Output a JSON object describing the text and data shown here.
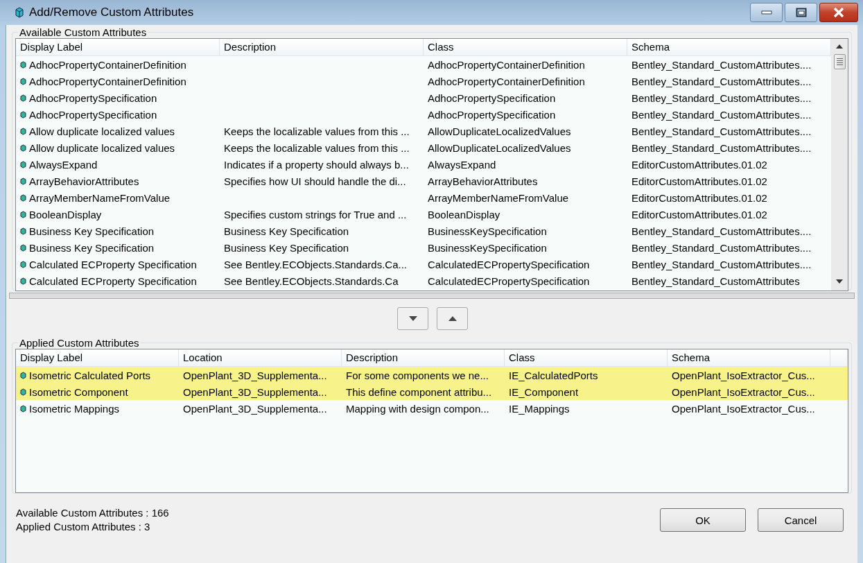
{
  "window": {
    "title": "Add/Remove Custom Attributes"
  },
  "available": {
    "title": "Available Custom Attributes",
    "columns": [
      "Display Label",
      "Description",
      "Class",
      "Schema"
    ],
    "rows": [
      {
        "cells": [
          "AdhocPropertyContainerDefinition",
          "",
          "AdhocPropertyContainerDefinition",
          "Bentley_Standard_CustomAttributes...."
        ]
      },
      {
        "cells": [
          "AdhocPropertyContainerDefinition",
          "",
          "AdhocPropertyContainerDefinition",
          "Bentley_Standard_CustomAttributes...."
        ]
      },
      {
        "cells": [
          "AdhocPropertySpecification",
          "",
          "AdhocPropertySpecification",
          "Bentley_Standard_CustomAttributes...."
        ]
      },
      {
        "cells": [
          "AdhocPropertySpecification",
          "",
          "AdhocPropertySpecification",
          "Bentley_Standard_CustomAttributes...."
        ]
      },
      {
        "cells": [
          "Allow duplicate localized values",
          "Keeps the localizable values from this ...",
          "AllowDuplicateLocalizedValues",
          "Bentley_Standard_CustomAttributes...."
        ]
      },
      {
        "cells": [
          "Allow duplicate localized values",
          "Keeps the localizable values from this ...",
          "AllowDuplicateLocalizedValues",
          "Bentley_Standard_CustomAttributes...."
        ]
      },
      {
        "cells": [
          "AlwaysExpand",
          "Indicates if a property should always b...",
          "AlwaysExpand",
          "EditorCustomAttributes.01.02"
        ]
      },
      {
        "cells": [
          "ArrayBehaviorAttributes",
          "Specifies how UI should handle the di...",
          "ArrayBehaviorAttributes",
          "EditorCustomAttributes.01.02"
        ]
      },
      {
        "cells": [
          "ArrayMemberNameFromValue",
          "",
          "ArrayMemberNameFromValue",
          "EditorCustomAttributes.01.02"
        ]
      },
      {
        "cells": [
          "BooleanDisplay",
          "Specifies custom strings for True and ...",
          "BooleanDisplay",
          "EditorCustomAttributes.01.02"
        ]
      },
      {
        "cells": [
          "Business Key Specification",
          "Business Key Specification",
          "BusinessKeySpecification",
          "Bentley_Standard_CustomAttributes...."
        ]
      },
      {
        "cells": [
          "Business Key Specification",
          "Business Key Specification",
          "BusinessKeySpecification",
          "Bentley_Standard_CustomAttributes...."
        ]
      },
      {
        "cells": [
          "Calculated ECProperty Specification",
          "See Bentley.ECObjects.Standards.Ca...",
          "CalculatedECPropertySpecification",
          "Bentley_Standard_CustomAttributes...."
        ]
      },
      {
        "cells": [
          "Calculated ECProperty Specification",
          "See Bentley.ECObjects.Standards.Ca",
          "CalculatedECPropertySpecification",
          "Bentley_Standard_CustomAttributes"
        ]
      }
    ]
  },
  "applied": {
    "title": "Applied Custom Attributes",
    "columns": [
      "Display Label",
      "Location",
      "Description",
      "Class",
      "Schema"
    ],
    "rows": [
      {
        "selected": true,
        "cells": [
          "Isometric Calculated Ports",
          "OpenPlant_3D_Supplementa...",
          "For some components we ne...",
          "IE_CalculatedPorts",
          "OpenPlant_IsoExtractor_Cus..."
        ]
      },
      {
        "selected": true,
        "cells": [
          "Isometric Component",
          "OpenPlant_3D_Supplementa...",
          "This define component attribu...",
          "IE_Component",
          "OpenPlant_IsoExtractor_Cus..."
        ]
      },
      {
        "selected": false,
        "cells": [
          "Isometric Mappings",
          "OpenPlant_3D_Supplementa...",
          "Mapping with design compon...",
          "IE_Mappings",
          "OpenPlant_IsoExtractor_Cus..."
        ]
      }
    ]
  },
  "status": [
    "Available Custom Attributes : 166",
    "Applied Custom Attributes : 3"
  ],
  "buttons": [
    "OK",
    "Cancel"
  ]
}
